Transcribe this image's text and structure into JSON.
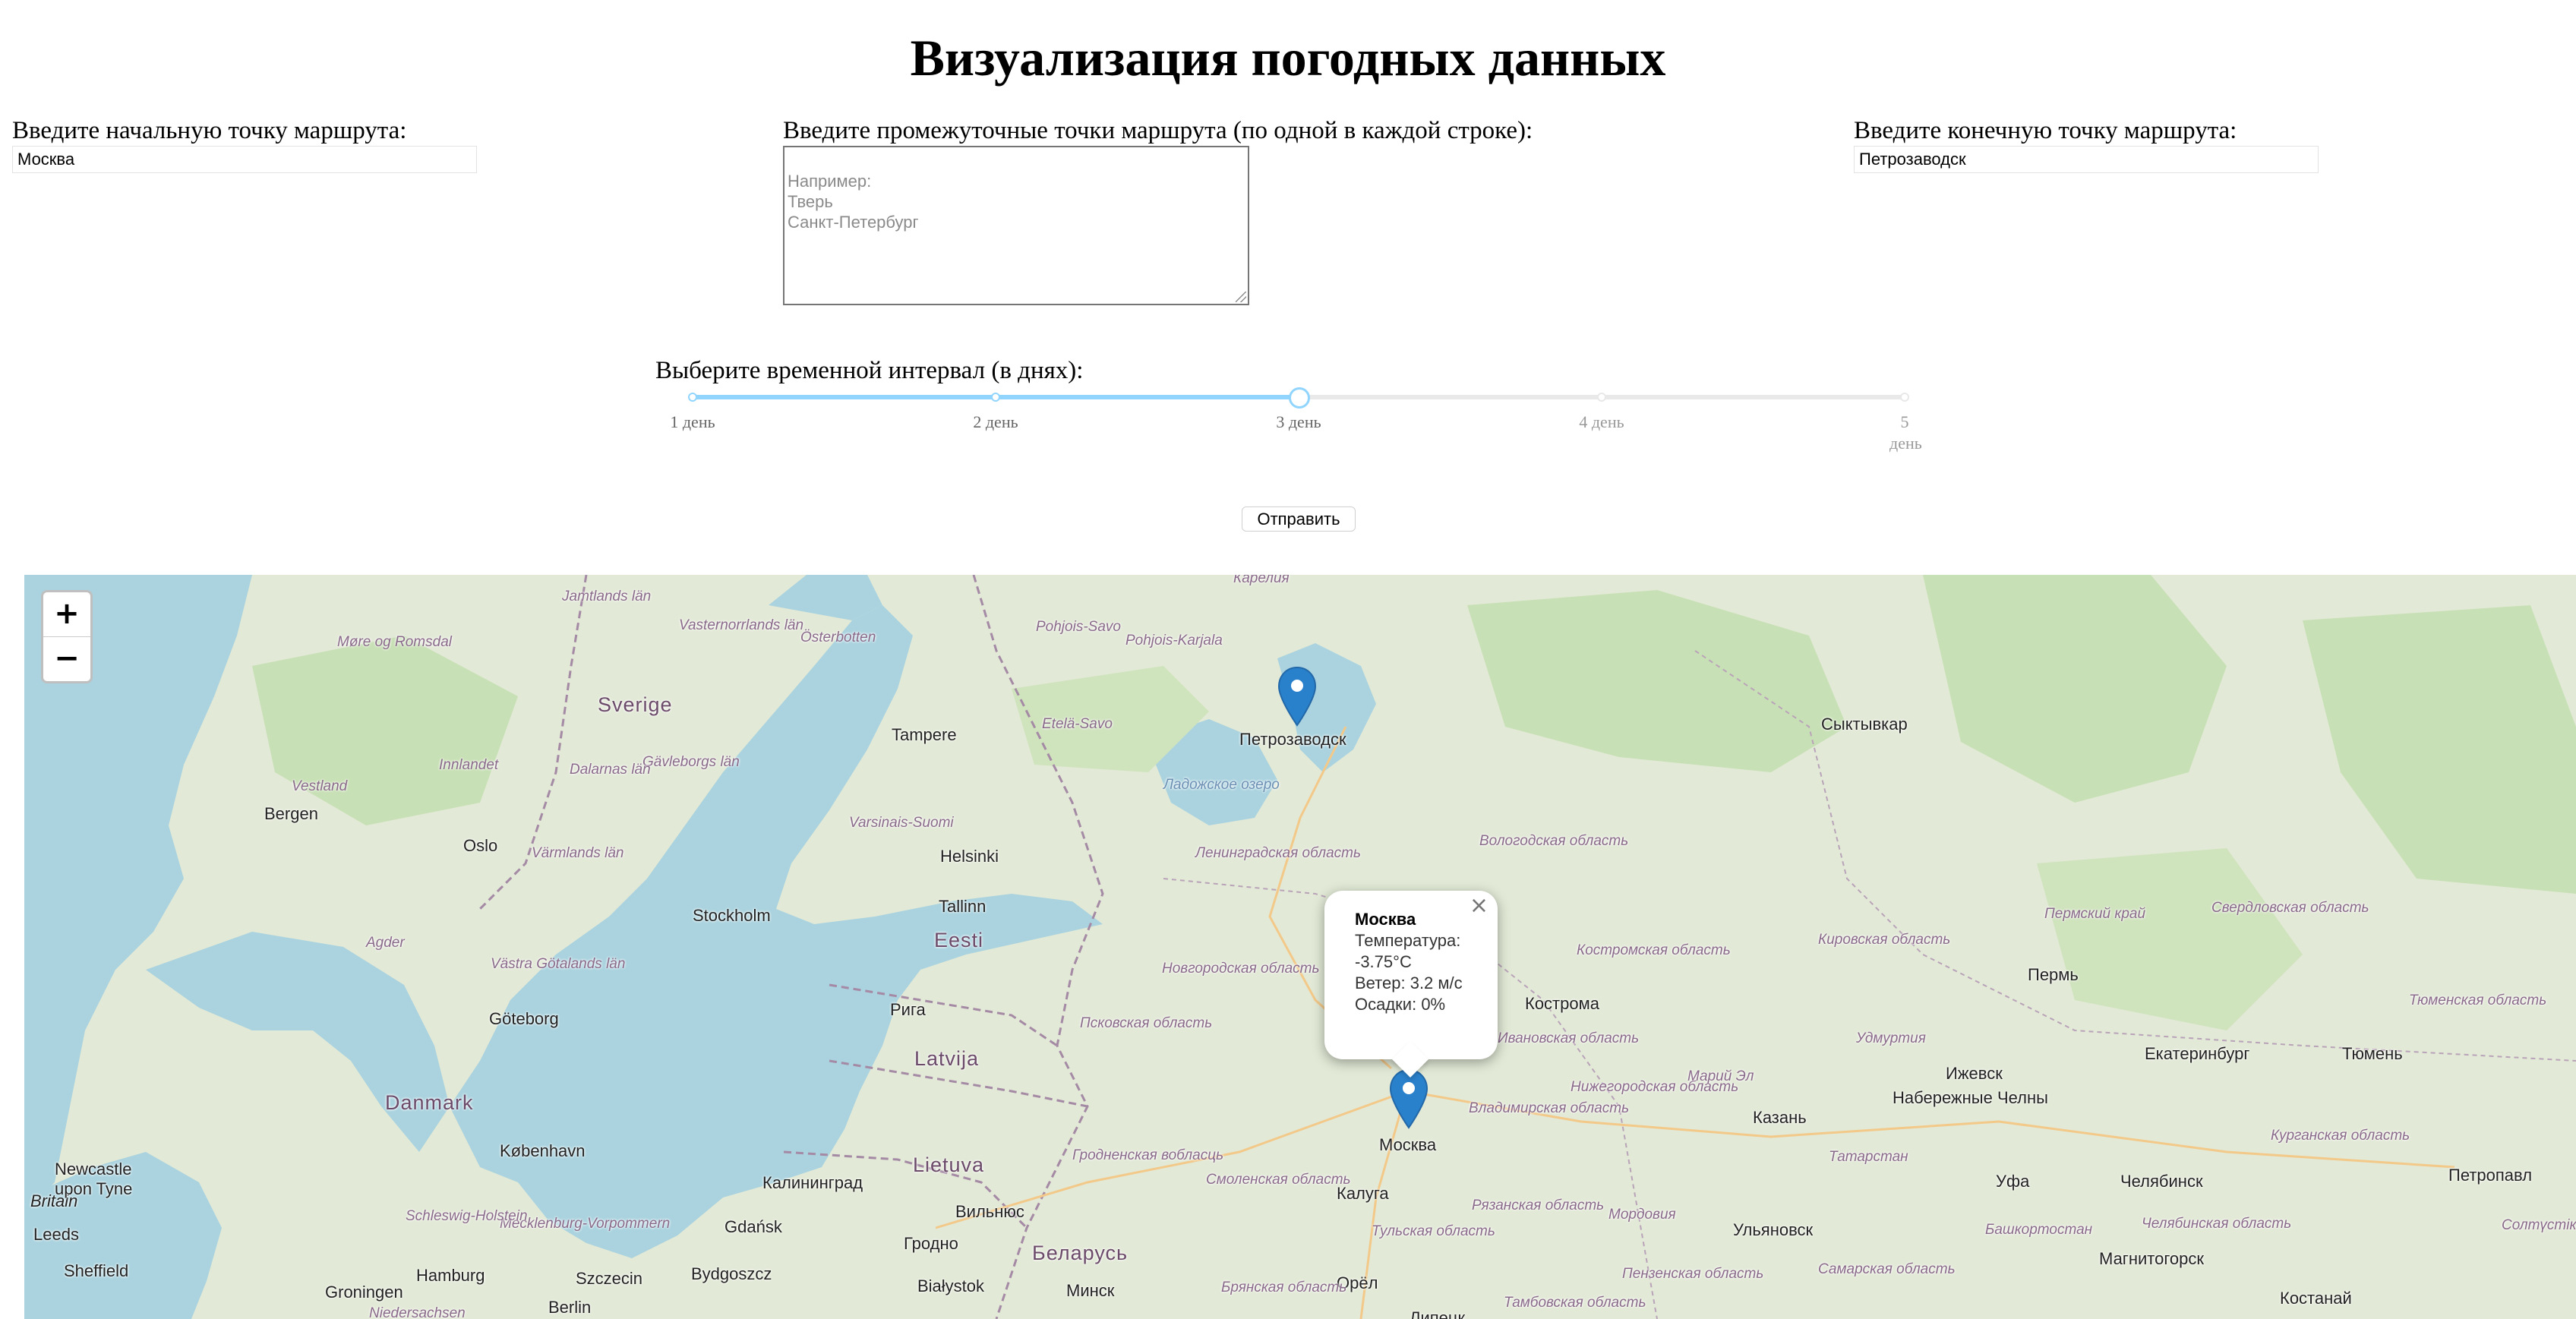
{
  "page_title": "Визуализация погодных данных",
  "start": {
    "label": "Введите начальную точку маршрута:",
    "value": "Москва"
  },
  "middle": {
    "label": "Введите промежуточные точки маршрута (по одной в каждой строке):",
    "placeholder": "Например:\nТверь\nСанкт-Петербург"
  },
  "end": {
    "label": "Введите конечную точку маршрута:",
    "value": "Петрозаводск"
  },
  "interval": {
    "label": "Выберите временной интервал (в днях):",
    "min": 1,
    "max": 5,
    "selected": 3,
    "marks": [
      "1 день",
      "2 день",
      "3 день",
      "4 день",
      "5 день"
    ]
  },
  "submit_label": "Отправить",
  "map": {
    "zoom_in": "+",
    "zoom_out": "−",
    "popup": {
      "city": "Москва",
      "temperature": "Температура: -3.75°C",
      "wind": "Ветер: 3.2 м/с",
      "precip": "Осадки: 0%",
      "close": "×"
    },
    "markers": [
      "Петрозаводск",
      "Москва"
    ],
    "cities": [
      "Петрозаводск",
      "Москва",
      "Helsinki",
      "Tallinn",
      "Stockholm",
      "Oslo",
      "Bergen",
      "Tampere",
      "Göteborg",
      "København",
      "Сыктывкар",
      "Кострома",
      "Пермь",
      "Екатеринбург",
      "Тюмень",
      "Ижевск",
      "Набережные Челны",
      "Казань",
      "Уфа",
      "Челябинск",
      "Петропавл",
      "Ульяновск",
      "Магнитогорск",
      "Калуга",
      "Орёл",
      "Минск",
      "Вильнюс",
      "Рига",
      "Гродно",
      "Калининград",
      "Gdańsk",
      "Bydgoszcz",
      "Szczecin",
      "Hamburg",
      "Groningen",
      "Berlin",
      "Białystok",
      "Leeds",
      "Sheffield",
      "Newcastle upon Tyne",
      "Костанай",
      "Липецк"
    ],
    "countries": [
      "Sverige",
      "Eesti",
      "Latvija",
      "Lietuva",
      "Беларусь",
      "Danmark",
      "Britain"
    ],
    "regions": [
      "Ленинградская область",
      "Новгородская область",
      "Псковская область",
      "Вологодская область",
      "Ивановская область",
      "Костромская область",
      "Кировская область",
      "Пермский край",
      "Свердловская область",
      "Тюменская область",
      "Удмуртия",
      "Нижегородская область",
      "Марий Эл",
      "Владимирская область",
      "Смоленская область",
      "Тульская область",
      "Рязанская область",
      "Брянская область",
      "Мордовия",
      "Пензенская область",
      "Самарская область",
      "Татарстан",
      "Башкортостан",
      "Челябинская область",
      "Курганская область",
      "Тамбовская область",
      "Гродненская вобласць",
      "Vasternorrlands län",
      "Jamtlands län",
      "Gävleborgs län",
      "Dalarnas län",
      "Värmlands län",
      "Västra Götalands län",
      "Vestland",
      "Innlandet",
      "Agder",
      "Møre og Romsdal",
      "Pohjois-Savo",
      "Pohjois-Karjala",
      "Etelä-Savo",
      "Varsinais-Suomi",
      "Mecklenburg-Vorpommern",
      "Schleswig-Holstein",
      "Niedersachsen",
      "Солтүстік Қазақстан облысы",
      "Карелия"
    ],
    "sea": [
      "Ладожское озеро",
      "Österbotten"
    ]
  }
}
